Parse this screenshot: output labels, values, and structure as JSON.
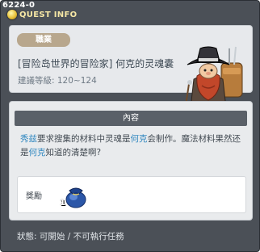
{
  "window": {
    "quest_id": "6224-0",
    "title": "QUEST INFO"
  },
  "header": {
    "category_tag": "職業",
    "quest_name": "[冒险岛世界的冒险家] 何克的灵魂囊",
    "level_label": "建議等級: 120~124"
  },
  "content": {
    "heading": "內容",
    "description_segments": [
      {
        "text": "秀兹",
        "highlight": true
      },
      {
        "text": "要求搜集的材料中灵魂是",
        "highlight": false
      },
      {
        "text": "何克",
        "highlight": true
      },
      {
        "text": "会制作。魔法材料果然还是",
        "highlight": false
      },
      {
        "text": "何克",
        "highlight": true
      },
      {
        "text": "知道的清楚啊?",
        "highlight": false
      }
    ],
    "reward_label": "獎勵",
    "reward_item_count": "1",
    "reward_item_icon": "blue-pouch-icon"
  },
  "status": {
    "text": "狀態: 可開始 / 不可執行任務"
  },
  "colors": {
    "highlight": "#2f87c0",
    "title_gold": "#f6e7a5",
    "tag_bg": "#b8a78d"
  }
}
